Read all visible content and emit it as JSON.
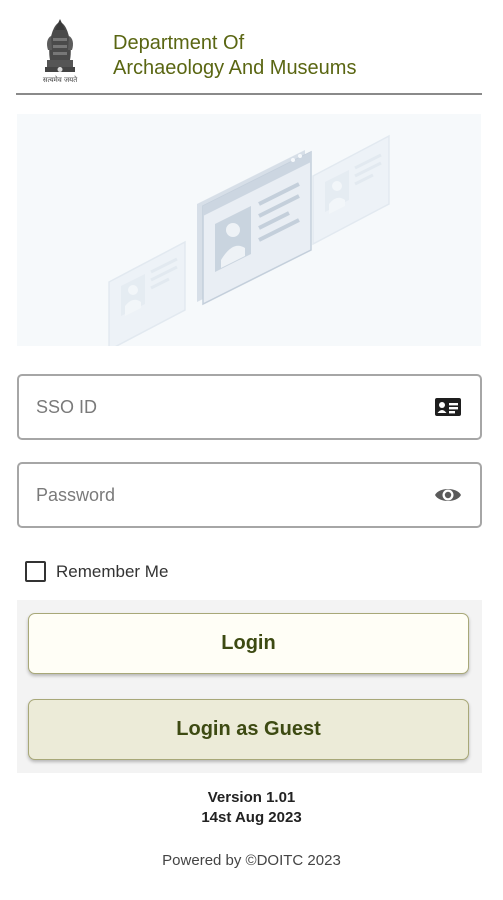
{
  "header": {
    "title_line1": "Department Of",
    "title_line2": "Archaeology And Museums",
    "emblem_icon": "state-emblem-icon",
    "emblem_caption": "सत्यमेव जयते",
    "title_color": "#5a6612"
  },
  "illustration": {
    "icon": "profile-cards-illustration"
  },
  "form": {
    "sso_placeholder": "SSO ID",
    "sso_value": "",
    "sso_icon": "id-card-icon",
    "password_placeholder": "Password",
    "password_value": "",
    "password_icon": "eye-icon",
    "remember_label": "Remember Me",
    "remember_checked": false
  },
  "buttons": {
    "login_label": "Login",
    "guest_label": "Login as Guest"
  },
  "footer": {
    "version": "Version 1.01",
    "date": "14st Aug 2023",
    "powered_by": "Powered by ©DOITC 2023"
  },
  "colors": {
    "accent": "#3d4a12",
    "button_border": "#a8a878",
    "guest_bg": "#ecebd8"
  }
}
